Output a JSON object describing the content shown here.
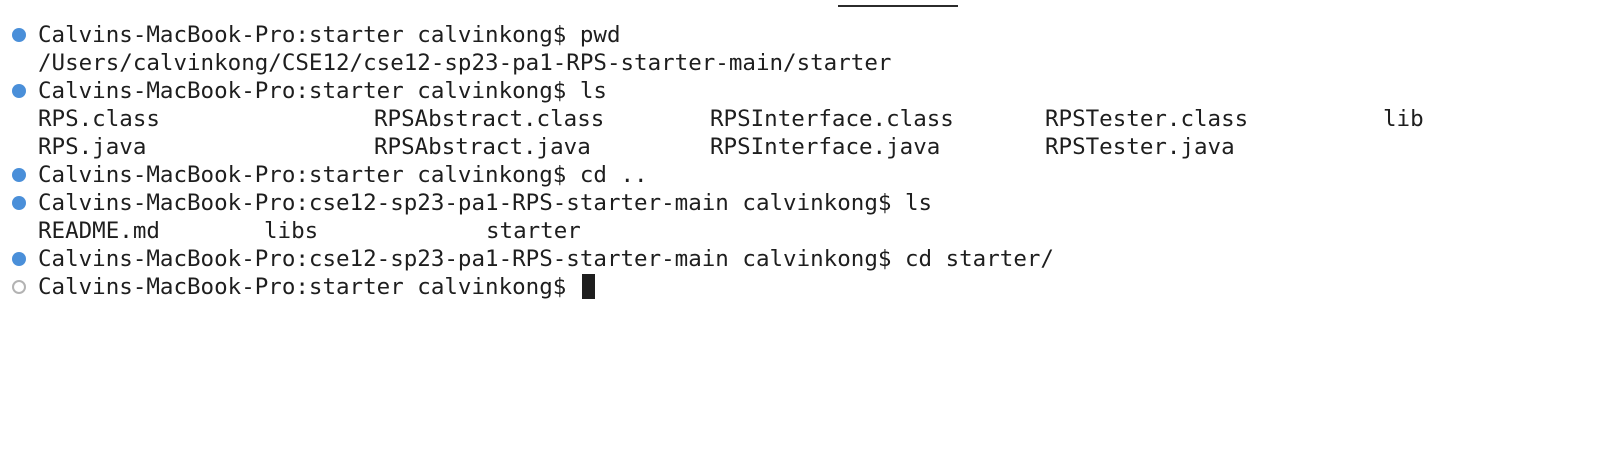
{
  "terminal": {
    "prompt_pwd": "Calvins-MacBook-Pro:starter calvinkong$ pwd",
    "pwd_output": "/Users/calvinkong/CSE12/cse12-sp23-pa1-RPS-starter-main/starter",
    "prompt_ls_1": "Calvins-MacBook-Pro:starter calvinkong$ ls",
    "ls_1_row_1": [
      "RPS.class",
      "RPSAbstract.class",
      "RPSInterface.class",
      "RPSTester.class",
      "lib"
    ],
    "ls_1_row_2": [
      "RPS.java",
      "RPSAbstract.java",
      "RPSInterface.java",
      "RPSTester.java"
    ],
    "prompt_cd_up": "Calvins-MacBook-Pro:starter calvinkong$ cd ..",
    "prompt_ls_2": "Calvins-MacBook-Pro:cse12-sp23-pa1-RPS-starter-main calvinkong$ ls",
    "ls_2_row_1": [
      "README.md",
      "libs",
      "starter"
    ],
    "prompt_cd_starter": "Calvins-MacBook-Pro:cse12-sp23-pa1-RPS-starter-main calvinkong$ cd starter/",
    "current_prompt": "Calvins-MacBook-Pro:starter calvinkong$ "
  },
  "colors": {
    "completed_marker": "#4a8fd9",
    "pending_marker": "#b3b3b3",
    "text": "#1e1e1e",
    "background": "#ffffff"
  }
}
